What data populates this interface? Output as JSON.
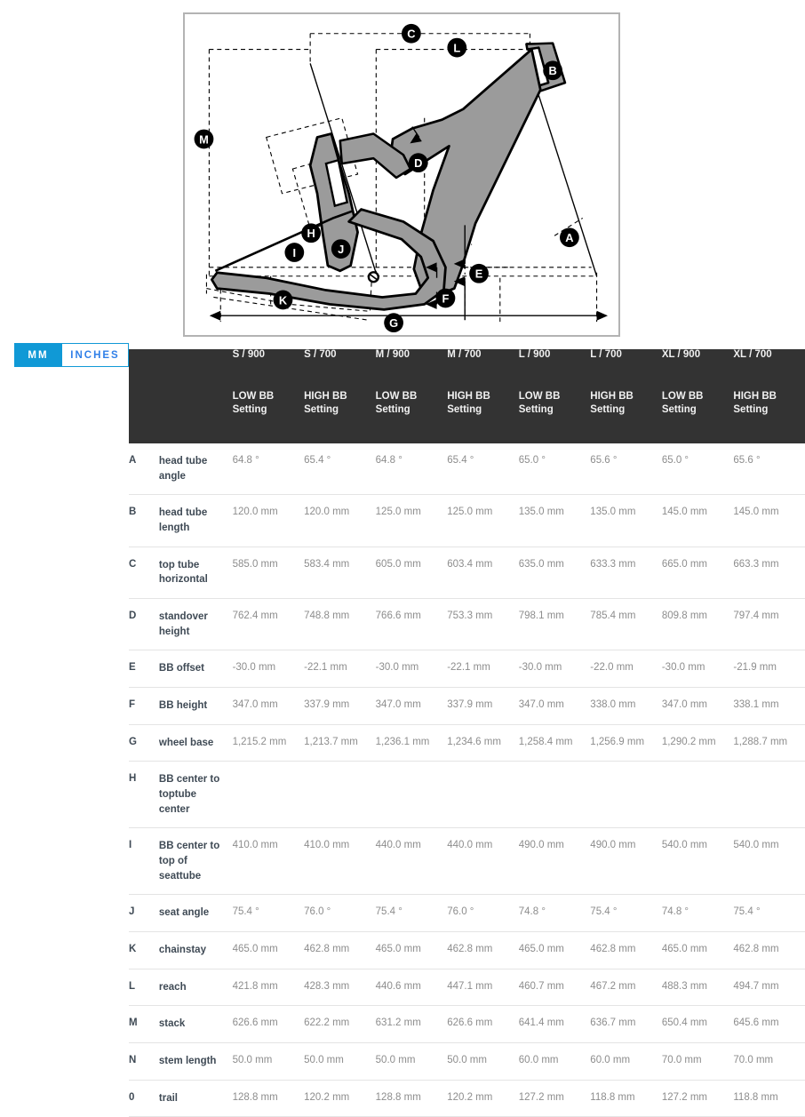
{
  "diagram": {
    "title": "bike-frame-geometry-diagram",
    "labels": [
      "A",
      "B",
      "C",
      "D",
      "E",
      "F",
      "G",
      "H",
      "I",
      "J",
      "K",
      "L",
      "M"
    ],
    "frame_color": "#9b9b9b",
    "outline_color": "#000000",
    "panel_border_color": "#b3b3b3"
  },
  "unit_toggle": {
    "active": "MM",
    "options": [
      {
        "label": "MM",
        "active": true
      },
      {
        "label": "INCHES",
        "active": false
      }
    ],
    "accent_color": "#1099d6",
    "inactive_text_color": "#2f7fe8"
  },
  "table": {
    "header_bg": "#333333",
    "header_text_color": "#f1f1f1",
    "cell_text_color": "#8d8d8d",
    "label_text_color": "#3f4a55",
    "columns": [
      {
        "size": "S / 900",
        "bb": "LOW BB Setting"
      },
      {
        "size": "S / 700",
        "bb": "HIGH BB Setting"
      },
      {
        "size": "M / 900",
        "bb": "LOW BB Setting"
      },
      {
        "size": "M / 700",
        "bb": "HIGH BB Setting"
      },
      {
        "size": "L / 900",
        "bb": "LOW BB Setting"
      },
      {
        "size": "L / 700",
        "bb": "HIGH BB Setting"
      },
      {
        "size": "XL / 900",
        "bb": "LOW BB Setting"
      },
      {
        "size": "XL / 700",
        "bb": "HIGH BB Setting"
      }
    ],
    "rows": [
      {
        "letter": "A",
        "name": "head tube angle",
        "values": [
          "64.8 °",
          "65.4 °",
          "64.8 °",
          "65.4 °",
          "65.0 °",
          "65.6 °",
          "65.0 °",
          "65.6 °"
        ]
      },
      {
        "letter": "B",
        "name": "head tube length",
        "values": [
          "120.0 mm",
          "120.0 mm",
          "125.0 mm",
          "125.0 mm",
          "135.0 mm",
          "135.0 mm",
          "145.0 mm",
          "145.0 mm"
        ]
      },
      {
        "letter": "C",
        "name": "top tube horizontal",
        "values": [
          "585.0 mm",
          "583.4 mm",
          "605.0 mm",
          "603.4 mm",
          "635.0 mm",
          "633.3 mm",
          "665.0 mm",
          "663.3 mm"
        ]
      },
      {
        "letter": "D",
        "name": "standover height",
        "values": [
          "762.4 mm",
          "748.8 mm",
          "766.6 mm",
          "753.3 mm",
          "798.1 mm",
          "785.4 mm",
          "809.8 mm",
          "797.4 mm"
        ]
      },
      {
        "letter": "E",
        "name": "BB offset",
        "values": [
          "-30.0 mm",
          "-22.1 mm",
          "-30.0 mm",
          "-22.1 mm",
          "-30.0 mm",
          "-22.0 mm",
          "-30.0 mm",
          "-21.9 mm"
        ]
      },
      {
        "letter": "F",
        "name": "BB height",
        "values": [
          "347.0 mm",
          "337.9 mm",
          "347.0 mm",
          "337.9 mm",
          "347.0 mm",
          "338.0 mm",
          "347.0 mm",
          "338.1 mm"
        ]
      },
      {
        "letter": "G",
        "name": "wheel base",
        "values": [
          "1,215.2 mm",
          "1,213.7 mm",
          "1,236.1 mm",
          "1,234.6 mm",
          "1,258.4 mm",
          "1,256.9 mm",
          "1,290.2 mm",
          "1,288.7 mm"
        ]
      },
      {
        "letter": "H",
        "name": "BB center to toptube center",
        "values": [
          "",
          "",
          "",
          "",
          "",
          "",
          "",
          ""
        ]
      },
      {
        "letter": "I",
        "name": "BB center to top of seattube",
        "values": [
          "410.0 mm",
          "410.0 mm",
          "440.0 mm",
          "440.0 mm",
          "490.0 mm",
          "490.0 mm",
          "540.0 mm",
          "540.0 mm"
        ]
      },
      {
        "letter": "J",
        "name": "seat angle",
        "values": [
          "75.4 °",
          "76.0 °",
          "75.4 °",
          "76.0 °",
          "74.8 °",
          "75.4 °",
          "74.8 °",
          "75.4 °"
        ]
      },
      {
        "letter": "K",
        "name": "chainstay",
        "values": [
          "465.0 mm",
          "462.8 mm",
          "465.0 mm",
          "462.8 mm",
          "465.0 mm",
          "462.8 mm",
          "465.0 mm",
          "462.8 mm"
        ]
      },
      {
        "letter": "L",
        "name": "reach",
        "values": [
          "421.8 mm",
          "428.3 mm",
          "440.6 mm",
          "447.1 mm",
          "460.7 mm",
          "467.2 mm",
          "488.3 mm",
          "494.7 mm"
        ]
      },
      {
        "letter": "M",
        "name": "stack",
        "values": [
          "626.6 mm",
          "622.2 mm",
          "631.2 mm",
          "626.6 mm",
          "641.4 mm",
          "636.7 mm",
          "650.4 mm",
          "645.6 mm"
        ]
      },
      {
        "letter": "N",
        "name": "stem length",
        "values": [
          "50.0 mm",
          "50.0 mm",
          "50.0 mm",
          "50.0 mm",
          "60.0 mm",
          "60.0 mm",
          "70.0 mm",
          "70.0 mm"
        ]
      },
      {
        "letter": "0",
        "name": "trail",
        "values": [
          "128.8 mm",
          "120.2 mm",
          "128.8 mm",
          "120.2 mm",
          "127.2 mm",
          "118.8 mm",
          "127.2 mm",
          "118.8 mm"
        ]
      }
    ]
  }
}
